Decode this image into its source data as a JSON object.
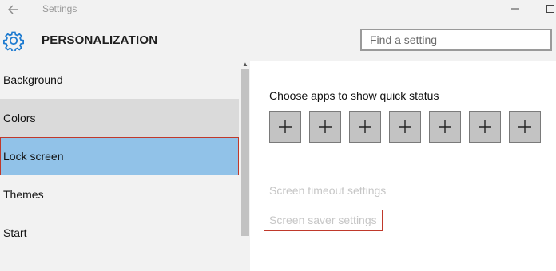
{
  "window": {
    "title": "Settings",
    "buttons": {
      "minimize": "minimize",
      "maximize": "maximize"
    }
  },
  "header": {
    "section_title": "PERSONALIZATION",
    "search_placeholder": "Find a setting"
  },
  "sidebar": {
    "items": [
      {
        "label": "Background",
        "state": "normal"
      },
      {
        "label": "Colors",
        "state": "hover"
      },
      {
        "label": "Lock screen",
        "state": "selected"
      },
      {
        "label": "Themes",
        "state": "normal"
      },
      {
        "label": "Start",
        "state": "normal"
      }
    ]
  },
  "main": {
    "quick_status_label": "Choose apps to show quick status",
    "quick_status_tiles": [
      "add-icon",
      "add-icon",
      "add-icon",
      "add-icon",
      "add-icon",
      "add-icon",
      "add-icon"
    ],
    "screen_timeout_link": "Screen timeout settings",
    "screen_saver_link": "Screen saver settings"
  },
  "colors": {
    "accent": "#1e7bd0",
    "selected_item": "#91c2e8",
    "highlight_border": "#c0392b",
    "disabled_link": "#c6c6c6"
  }
}
